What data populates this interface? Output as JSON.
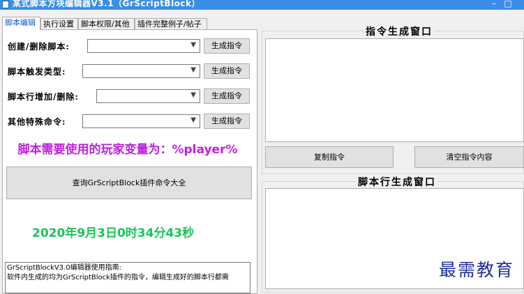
{
  "window": {
    "title": "某式脚本方块编辑器V3.1（GrScriptBlock）",
    "minimize_glyph": "–",
    "maximize_glyph": "□"
  },
  "tabs": [
    {
      "label": "脚本编辑",
      "active": true
    },
    {
      "label": "执行设置",
      "active": false
    },
    {
      "label": "脚本权限/其他",
      "active": false
    },
    {
      "label": "插件完整例子/帖子",
      "active": false
    }
  ],
  "editor": {
    "rows": [
      {
        "label": "创建/删除脚本:",
        "selected": "",
        "button": "生成指令"
      },
      {
        "label": "脚本触发类型:",
        "selected": "",
        "button": "生成指令"
      },
      {
        "label": "脚本行增加/删除:",
        "selected": "",
        "button": "生成指令"
      },
      {
        "label": "其他特殊命令:",
        "selected": "",
        "button": "生成指令"
      }
    ],
    "player_var_text": "脚本需要使用的玩家变量为：%player%",
    "query_button": "查询GrScriptBlock插件命令大全",
    "datetime": "2020年9月3日0时34分43秒",
    "guide_lines": [
      "GrScriptBlockV3.0编辑器使用指南:",
      "软件内生成的均为GrScriptBlock插件的指令，编辑生成好的脚本行都需"
    ]
  },
  "command_window": {
    "title": "指令生成窗口",
    "content": "",
    "copy_button": "复制指令",
    "clear_button": "清空指令内容"
  },
  "script_window": {
    "title": "脚本行生成窗口",
    "content": ""
  },
  "watermark": "最需教育",
  "colors": {
    "titlebar": "#3a8ee6",
    "player_var": "#c020e0",
    "datetime": "#19c45a",
    "active_tab": "#0b5bd3",
    "watermark": "#1e2f9a"
  }
}
